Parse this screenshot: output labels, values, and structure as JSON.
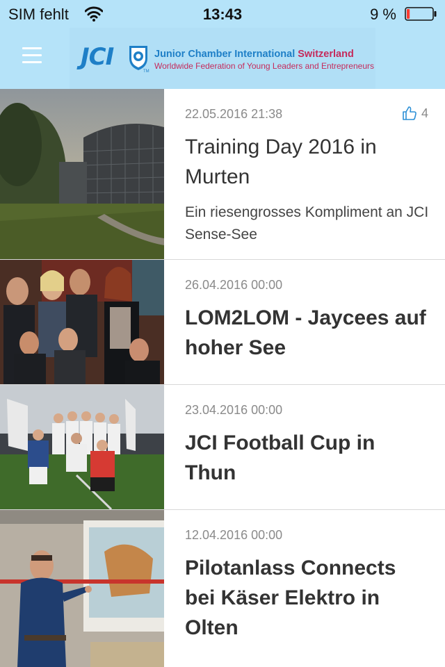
{
  "status_bar": {
    "carrier": "SIM fehlt",
    "time": "13:43",
    "battery_percent": "9 %",
    "battery_level": 0.09,
    "battery_color": "#ff3b30"
  },
  "header": {
    "background": "#b5e3f9",
    "menu_icon": "hamburger-icon",
    "logo": {
      "mark": "JCI",
      "line1_prefix": "Junior Chamber International ",
      "line1_accent": "Switzerland",
      "line2": "Worldwide Federation of Young Leaders and Entrepreneurs",
      "tm": "TM",
      "brand_blue": "#1e7fc7",
      "brand_red": "#c52a5b"
    }
  },
  "articles": [
    {
      "date": "22.05.2016 21:38",
      "title": "Training Day 2016 in Murten",
      "excerpt": "Ein riesengrosses Kompliment an JCI Sense-See",
      "likes": "4",
      "like_icon": "thumbs-up-icon",
      "image": "modern-glass-building-photo"
    },
    {
      "date": "26.04.2016 00:00",
      "title": "LOM2LOM - Jaycees auf hoher See",
      "image": "group-photo"
    },
    {
      "date": "23.04.2016 00:00",
      "title": "JCI Football Cup in Thun",
      "image": "football-team-photo"
    },
    {
      "date": "12.04.2016 00:00",
      "title": "Pilotanlass Connects bei Käser Elektro in Olten",
      "image": "presenter-photo"
    }
  ]
}
